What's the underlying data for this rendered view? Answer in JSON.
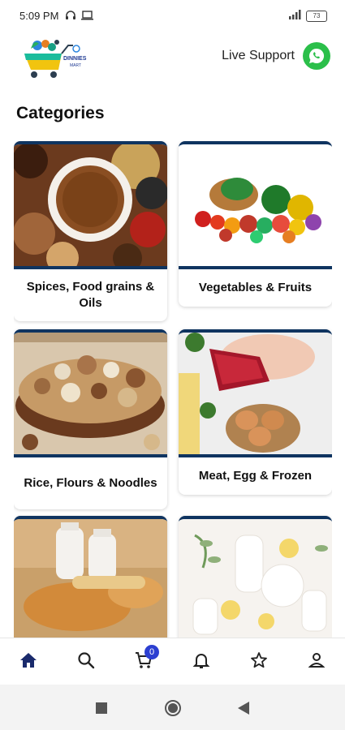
{
  "status": {
    "time": "5:09 PM",
    "battery": "73"
  },
  "header": {
    "brand_name": "DINNIES",
    "brand_sub": "MART",
    "live_support_label": "Live Support"
  },
  "main": {
    "title": "Categories",
    "categories": [
      {
        "label": "Spices, Food grains & Oils"
      },
      {
        "label": "Vegetables & Fruits"
      },
      {
        "label": "Rice, Flours & Noodles"
      },
      {
        "label": "Meat, Egg & Frozen"
      },
      {
        "label": ""
      },
      {
        "label": ""
      }
    ]
  },
  "bottom_nav": {
    "cart_count": "0",
    "active": "home"
  },
  "colors": {
    "accent": "#0f3460",
    "badge": "#2c3fd1",
    "whatsapp": "#2bbf4a",
    "nav_icon": "#222222"
  },
  "icons": [
    "home-icon",
    "search-icon",
    "cart-icon",
    "bell-icon",
    "star-icon",
    "user-icon",
    "whatsapp-icon",
    "headphones-icon",
    "laptop-icon",
    "signal-icon",
    "battery-icon"
  ]
}
